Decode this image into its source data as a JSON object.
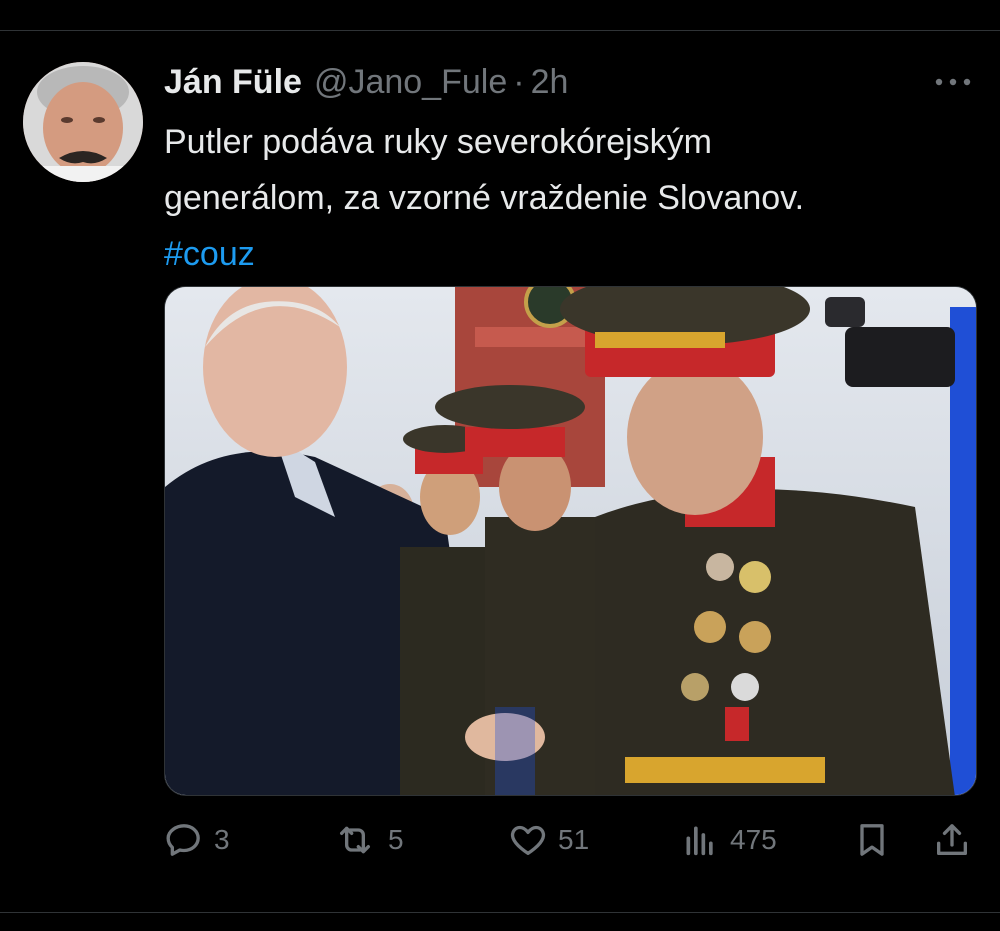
{
  "tweet": {
    "author": {
      "display_name": "Ján Füle",
      "handle": "@Jano_Fule",
      "separator": "·",
      "time": "2h"
    },
    "text_lines": [
      "Putler podáva ruky severokórejským",
      "generálom, za vzorné vraždenie Slovanov."
    ],
    "hashtag": "#couz"
  },
  "actions": {
    "replies": "3",
    "reposts": "5",
    "likes": "51",
    "views": "475"
  },
  "colors": {
    "background": "#000000",
    "text": "#e7e9ea",
    "muted": "#71767b",
    "accent": "#1d9bf0",
    "divider": "#2f3336"
  },
  "icons": [
    "more-icon",
    "reply-icon",
    "repost-icon",
    "like-icon",
    "views-icon",
    "bookmark-icon",
    "share-icon"
  ]
}
